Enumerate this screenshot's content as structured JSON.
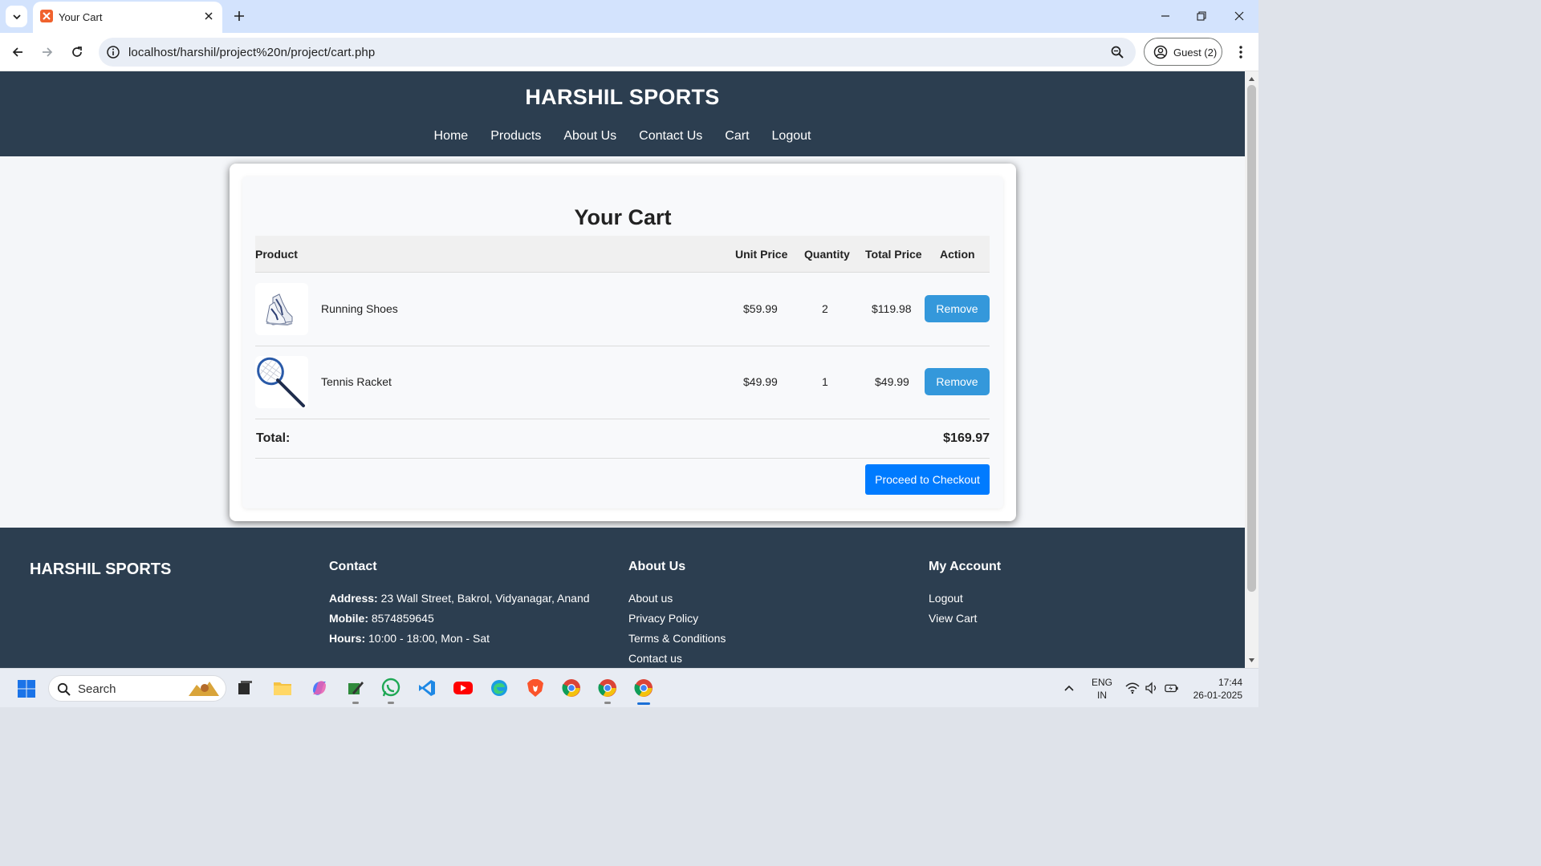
{
  "browser": {
    "tab_title": "Your Cart",
    "url": "localhost/harshil/project%20n/project/cart.php",
    "profile_label": "Guest (2)"
  },
  "site": {
    "title": "HARSHIL SPORTS",
    "nav": [
      "Home",
      "Products",
      "About Us",
      "Contact Us",
      "Cart",
      "Logout"
    ]
  },
  "cart": {
    "title": "Your Cart",
    "columns": {
      "product": "Product",
      "unit_price": "Unit Price",
      "quantity": "Quantity",
      "total_price": "Total Price",
      "action": "Action"
    },
    "items": [
      {
        "name": "Running Shoes",
        "unit_price": "$59.99",
        "quantity": "2",
        "total_price": "$119.98",
        "action": "Remove",
        "image": "running-shoes"
      },
      {
        "name": "Tennis Racket",
        "unit_price": "$49.99",
        "quantity": "1",
        "total_price": "$49.99",
        "action": "Remove",
        "image": "tennis-racket"
      }
    ],
    "total_label": "Total:",
    "total_value": "$169.97",
    "checkout_label": "Proceed to Checkout"
  },
  "footer": {
    "brand": "HARSHIL SPORTS",
    "contact": {
      "heading": "Contact",
      "address_label": "Address:",
      "address": "23 Wall Street, Bakrol, Vidyanagar, Anand",
      "mobile_label": "Mobile:",
      "mobile": "8574859645",
      "hours_label": "Hours:",
      "hours": "10:00 - 18:00, Mon - Sat"
    },
    "about": {
      "heading": "About Us",
      "links": [
        "About us",
        "Privacy Policy",
        "Terms & Conditions",
        "Contact us"
      ]
    },
    "account": {
      "heading": "My Account",
      "links": [
        "Logout",
        "View Cart"
      ]
    }
  },
  "taskbar": {
    "search_placeholder": "Search",
    "lang_line1": "ENG",
    "lang_line2": "IN",
    "time": "17:44",
    "date": "26-01-2025"
  },
  "colors": {
    "header_bg": "#2c3e50",
    "remove_button": "#3498db",
    "checkout_button": "#007bff"
  }
}
